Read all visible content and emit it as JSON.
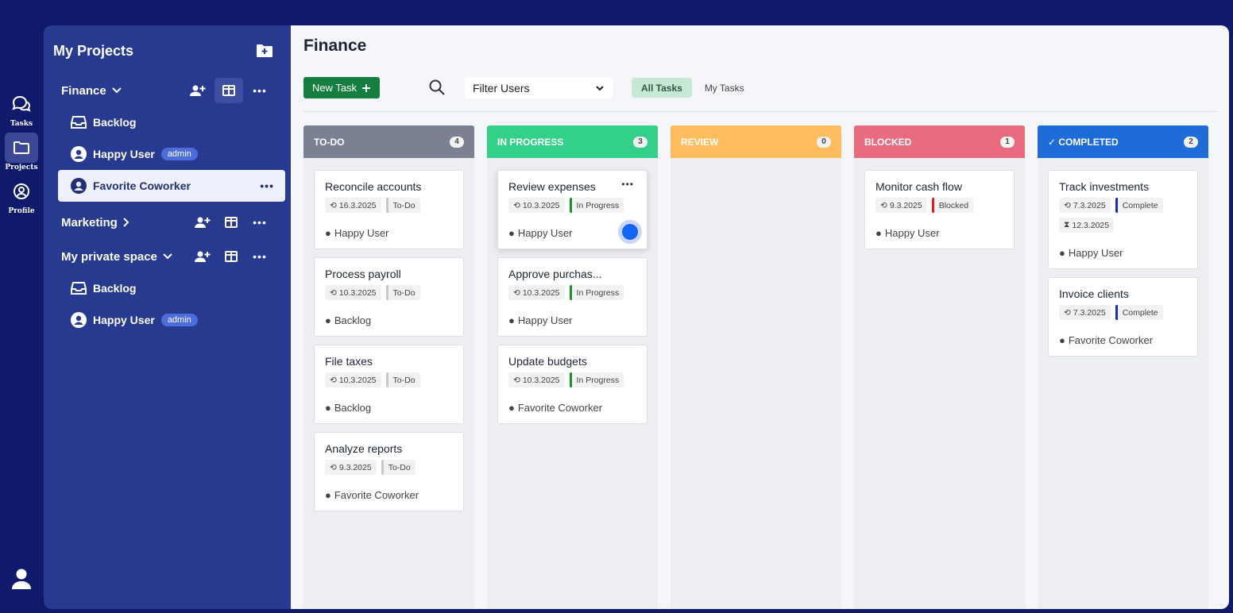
{
  "colors": {
    "frame": "#0f1a6b",
    "sidebar": "#283a8f",
    "todo": "#7b8093",
    "in_progress": "#33d08a",
    "review": "#ffbd5e",
    "blocked": "#e96b80",
    "completed": "#1e6cd8",
    "new_task": "#137e3e"
  },
  "rail": {
    "items": [
      {
        "label": "Tasks",
        "icon": "chat-bubbles-icon"
      },
      {
        "label": "Projects",
        "icon": "folder-icon"
      },
      {
        "label": "Profile",
        "icon": "user-circle-icon"
      }
    ]
  },
  "sidebar": {
    "title": "My Projects",
    "projects": [
      {
        "name": "Finance",
        "subs": [
          {
            "label": "Backlog"
          },
          {
            "label": "Happy User",
            "badge": "admin"
          },
          {
            "label": "Favorite Coworker"
          }
        ]
      },
      {
        "name": "Marketing"
      },
      {
        "name": "My private space",
        "subs": [
          {
            "label": "Backlog"
          },
          {
            "label": "Happy User",
            "badge": "admin"
          }
        ]
      }
    ]
  },
  "main": {
    "title": "Finance",
    "new_task_label": "New Task",
    "filter_label": "Filter Users",
    "tabs": [
      "All Tasks",
      "My Tasks"
    ]
  },
  "board": {
    "columns": [
      {
        "title": "TO-DO",
        "count": "4",
        "cards": [
          {
            "title": "Reconcile accounts",
            "date": "16.3.2025",
            "status": "To-Do",
            "assignee": "Happy User"
          },
          {
            "title": "Process payroll",
            "date": "10.3.2025",
            "status": "To-Do",
            "assignee": "Backlog"
          },
          {
            "title": "File taxes",
            "date": "10.3.2025",
            "status": "To-Do",
            "assignee": "Backlog"
          },
          {
            "title": "Analyze reports",
            "date": "9.3.2025",
            "status": "To-Do",
            "assignee": "Favorite Coworker"
          }
        ]
      },
      {
        "title": "IN PROGRESS",
        "count": "3",
        "cards": [
          {
            "title": "Review expenses",
            "date": "10.3.2025",
            "status": "In Progress",
            "assignee": "Happy User"
          },
          {
            "title": "Approve purchas...",
            "date": "10.3.2025",
            "status": "In Progress",
            "assignee": "Happy User"
          },
          {
            "title": "Update budgets",
            "date": "10.3.2025",
            "status": "In Progress",
            "assignee": "Favorite Coworker"
          }
        ]
      },
      {
        "title": "REVIEW",
        "count": "0",
        "cards": []
      },
      {
        "title": "BLOCKED",
        "count": "1",
        "cards": [
          {
            "title": "Monitor cash flow",
            "date": "9.3.2025",
            "status": "Blocked",
            "assignee": "Happy User"
          }
        ]
      },
      {
        "title": "✓ COMPLETED",
        "count": "2",
        "cards": [
          {
            "title": "Track investments",
            "date": "7.3.2025",
            "status": "Complete",
            "due": "12.3.2025",
            "assignee": "Happy User"
          },
          {
            "title": "Invoice clients",
            "date": "7.3.2025",
            "status": "Complete",
            "assignee": "Favorite Coworker"
          }
        ]
      }
    ]
  }
}
